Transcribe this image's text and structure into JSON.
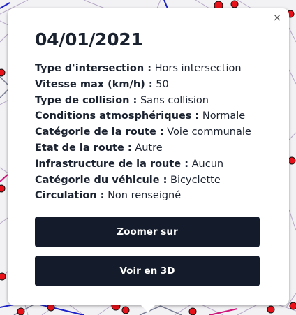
{
  "popup": {
    "close_label": "×",
    "title": "04/01/2021",
    "fields": [
      {
        "key": "Type d'intersection :",
        "value": "Hors intersection"
      },
      {
        "key": "Vitesse max (km/h) :",
        "value": "50"
      },
      {
        "key": "Type de collision :",
        "value": "Sans collision"
      },
      {
        "key": "Conditions atmosphériques :",
        "value": "Normale"
      },
      {
        "key": "Catégorie de la route :",
        "value": "Voie communale"
      },
      {
        "key": "Etat de la route :",
        "value": "Autre"
      },
      {
        "key": "Infrastructure de la route :",
        "value": "Aucun"
      },
      {
        "key": "Catégorie du véhicule :",
        "value": "Bicyclette"
      },
      {
        "key": "Circulation :",
        "value": "Non renseigné"
      }
    ],
    "buttons": {
      "zoom_label": "Zoomer sur",
      "view3d_label": "Voir en 3D"
    }
  },
  "colors": {
    "button_bg": "#141c2b",
    "marker": "#e8121b",
    "road_blue": "#1c22c9",
    "road_magenta": "#d0157a"
  }
}
